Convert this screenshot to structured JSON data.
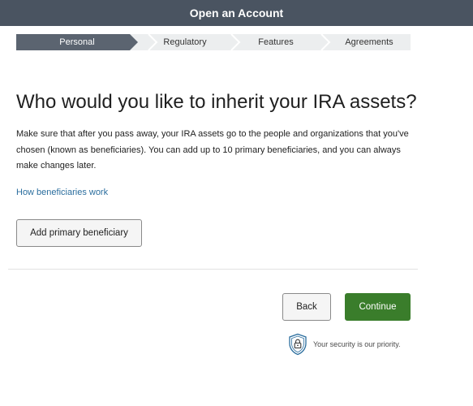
{
  "header": {
    "title": "Open an Account"
  },
  "steps": [
    {
      "label": "Personal",
      "active": true
    },
    {
      "label": "Regulatory",
      "active": false
    },
    {
      "label": "Features",
      "active": false
    },
    {
      "label": "Agreements",
      "active": false
    }
  ],
  "main": {
    "title": "Who would you like to inherit your IRA assets?",
    "description": "Make sure that after you pass away, your IRA assets go to the people and organizations that you've chosen (known as beneficiaries). You can add up to 10 primary beneficiaries, and you can always make changes later.",
    "link_label": "How beneficiaries work",
    "add_button_label": "Add primary beneficiary"
  },
  "footer": {
    "back_label": "Back",
    "continue_label": "Continue",
    "security_text": "Your security is our priority."
  },
  "colors": {
    "header_bg": "#4a5461",
    "active_step": "#5b6470",
    "link": "#2b6e9e",
    "primary_button": "#3a7d2b"
  },
  "icons": {
    "security": "shield-lock-icon"
  }
}
